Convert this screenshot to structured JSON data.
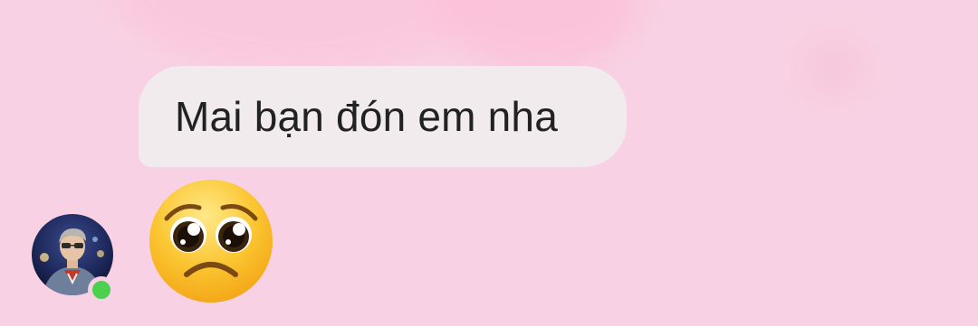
{
  "chat": {
    "messages": [
      {
        "type": "text",
        "text": "Mai bạn đón em nha"
      },
      {
        "type": "emoji",
        "icon": "pleading-face-emoji"
      }
    ],
    "sender": {
      "avatar": "user-avatar-photo",
      "status": "online",
      "status_color": "#4dd04f"
    }
  },
  "theme": {
    "background": "#f8d2e4",
    "bubble_color": "#f1ebed"
  }
}
